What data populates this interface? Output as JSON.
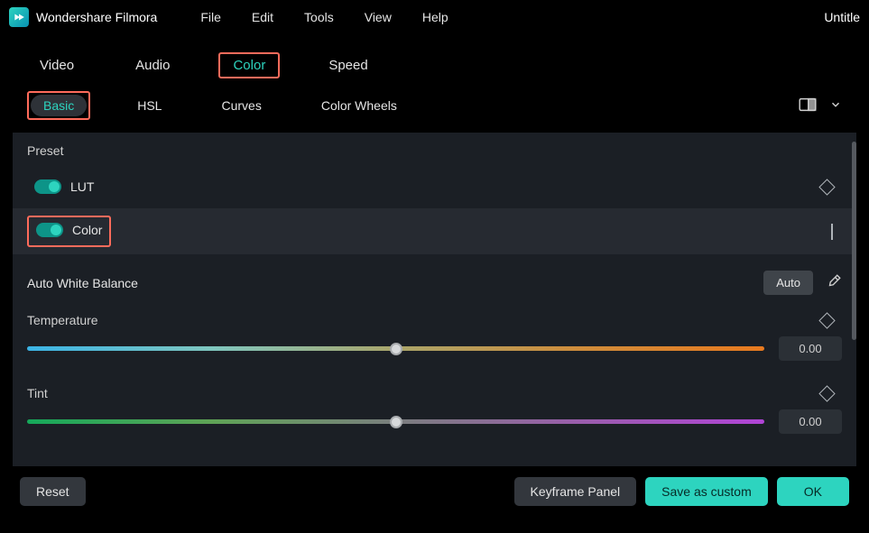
{
  "app": {
    "title": "Wondershare Filmora",
    "docTitle": "Untitle"
  },
  "menubar": {
    "file": "File",
    "edit": "Edit",
    "tools": "Tools",
    "view": "View",
    "help": "Help"
  },
  "tabs": {
    "video": "Video",
    "audio": "Audio",
    "color": "Color",
    "speed": "Speed"
  },
  "subtabs": {
    "basic": "Basic",
    "hsl": "HSL",
    "curves": "Curves",
    "wheels": "Color Wheels"
  },
  "panel": {
    "preset": "Preset",
    "lut": "LUT",
    "color": "Color",
    "awb": "Auto White Balance",
    "autoBtn": "Auto",
    "temperature": {
      "label": "Temperature",
      "value": "0.00"
    },
    "tint": {
      "label": "Tint",
      "value": "0.00"
    }
  },
  "footer": {
    "reset": "Reset",
    "keyframe": "Keyframe Panel",
    "save": "Save as custom",
    "ok": "OK"
  }
}
